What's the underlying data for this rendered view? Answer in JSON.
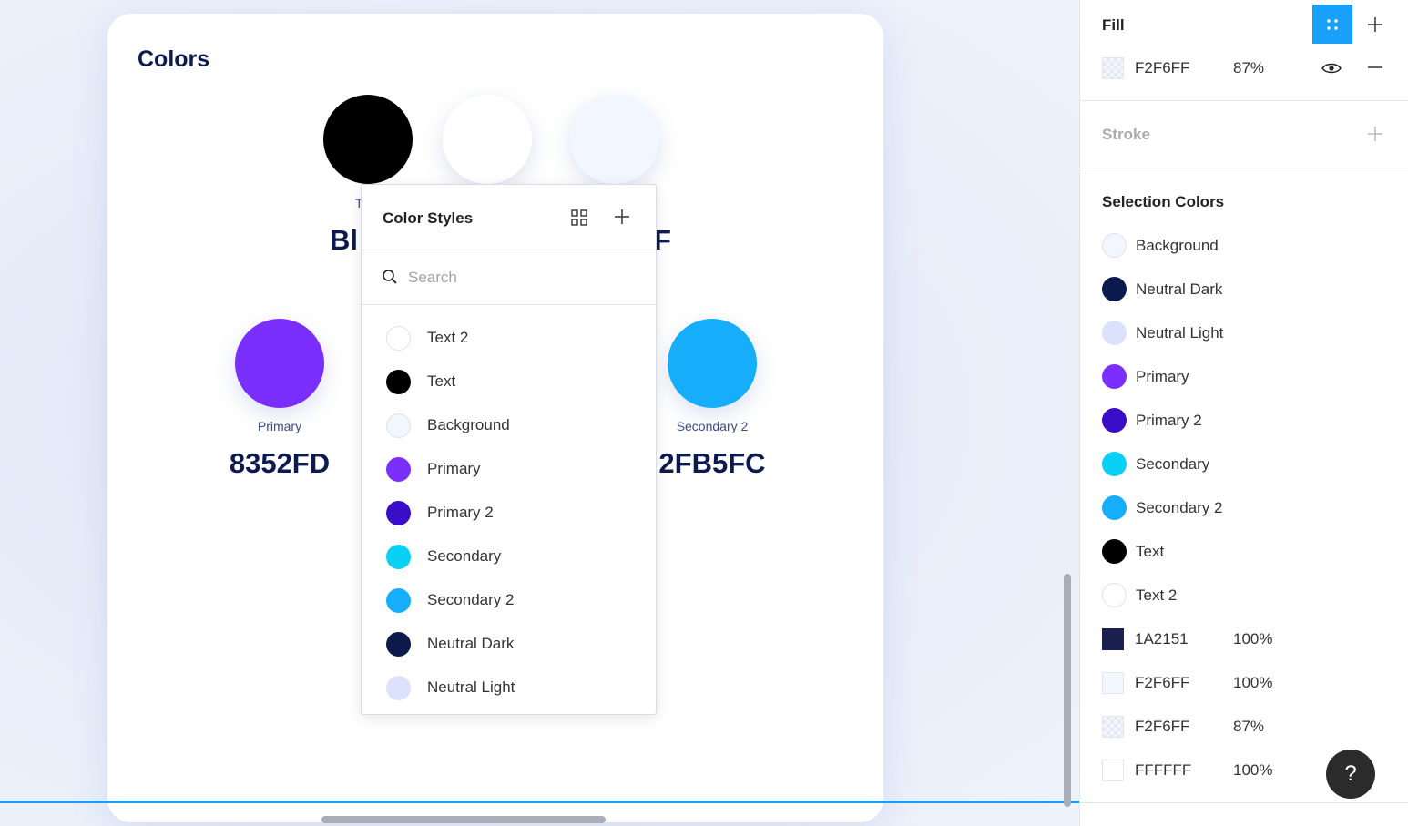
{
  "frame": {
    "title": "Colors",
    "partial_text_left": "Bl",
    "partial_text_under_black": "T",
    "partial_text_right": "F",
    "swatches": [
      {
        "name": "black",
        "color": "#000000"
      },
      {
        "name": "white",
        "color": "#FFFFFF"
      },
      {
        "name": "background",
        "color": "#F2F6FF"
      },
      {
        "name": "primary",
        "color": "#7B2FFF",
        "label": "Primary",
        "hex": "8352FD"
      },
      {
        "name": "secondary-2",
        "color": "#16AEFB",
        "label": "Secondary 2",
        "hex": "2FB5FC"
      }
    ]
  },
  "popup": {
    "title": "Color Styles",
    "search_placeholder": "Search",
    "items": [
      {
        "label": "Text 2",
        "color": "#FFFFFF",
        "outline": true
      },
      {
        "label": "Text",
        "color": "#000000",
        "outline": false
      },
      {
        "label": "Background",
        "color": "#F2F6FF",
        "outline": true
      },
      {
        "label": "Primary",
        "color": "#7B2FFF",
        "outline": false
      },
      {
        "label": "Primary 2",
        "color": "#3A0DC8",
        "outline": false
      },
      {
        "label": "Secondary",
        "color": "#0AD0F5",
        "outline": false
      },
      {
        "label": "Secondary 2",
        "color": "#16AEFB",
        "outline": false
      },
      {
        "label": "Neutral Dark",
        "color": "#0D1A4E",
        "outline": false
      },
      {
        "label": "Neutral Light",
        "color": "#DDE2FC",
        "outline": false
      }
    ]
  },
  "panel": {
    "fill": {
      "title": "Fill",
      "hex": "F2F6FF",
      "opacity": "87%"
    },
    "stroke": {
      "title": "Stroke"
    },
    "selection": {
      "title": "Selection Colors",
      "styles": [
        {
          "label": "Background",
          "color": "#F2F6FF",
          "outline": true
        },
        {
          "label": "Neutral Dark",
          "color": "#0D1A4E",
          "outline": false
        },
        {
          "label": "Neutral Light",
          "color": "#DDE2FC",
          "outline": false
        },
        {
          "label": "Primary",
          "color": "#7B2FFF",
          "outline": false
        },
        {
          "label": "Primary 2",
          "color": "#3A0DC8",
          "outline": false
        },
        {
          "label": "Secondary",
          "color": "#0AD0F5",
          "outline": false
        },
        {
          "label": "Secondary 2",
          "color": "#16AEFB",
          "outline": false
        },
        {
          "label": "Text",
          "color": "#000000",
          "outline": false
        },
        {
          "label": "Text 2",
          "color": "#FFFFFF",
          "outline": true
        }
      ],
      "raw": [
        {
          "hex": "1A2151",
          "opacity": "100%",
          "color": "#1A2151",
          "checker": false
        },
        {
          "hex": "F2F6FF",
          "opacity": "100%",
          "color": "#F2F6FF",
          "checker": false
        },
        {
          "hex": "F2F6FF",
          "opacity": "87%",
          "color": "#F2F6FF",
          "checker": true
        },
        {
          "hex": "FFFFFF",
          "opacity": "100%",
          "color": "#FFFFFF",
          "checker": false
        }
      ]
    },
    "help_label": "?"
  },
  "colors": {
    "accent": "#18A0FB",
    "selection_line": "#1E9BF0"
  }
}
